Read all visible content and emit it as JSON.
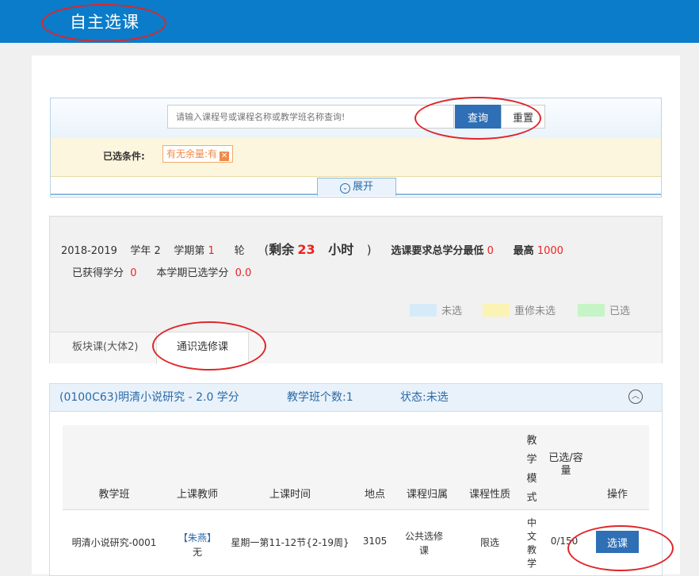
{
  "header": {
    "title": "自主选课"
  },
  "search": {
    "placeholder": "请输入课程号或课程名称或教学班名称查询!",
    "query_label": "查询",
    "reset_label": "重置"
  },
  "conditions": {
    "label": "已选条件:",
    "tag": "有无余量:有",
    "tag_close": "✕"
  },
  "expand_label": "展开",
  "summary": {
    "year": "2018-2019",
    "year_label": "学年",
    "year_suffix": "2",
    "term_label": "学期第",
    "round": "1",
    "round_label": "轮",
    "remain_open": "(",
    "remain_label": "剩余",
    "remain_value": "23",
    "remain_unit": "小时",
    "remain_close": ")",
    "credit_req_label": "选课要求总学分最低",
    "credit_min": "0",
    "credit_max_label": "最高",
    "credit_max": "1000",
    "earned_label": "已获得学分",
    "earned_value": "0",
    "term_selected_label": "本学期已选学分",
    "term_selected_value": "0.0"
  },
  "legend": [
    {
      "label": "未选",
      "color": "#d6ebf8"
    },
    {
      "label": "重修未选",
      "color": "#fbf3b4"
    },
    {
      "label": "已选",
      "color": "#c6f4c6"
    }
  ],
  "tabs": [
    {
      "label": "板块课(大体2)"
    },
    {
      "label": "通识选修课"
    }
  ],
  "course": {
    "title": "(0100C63)明清小说研究 - 2.0 学分",
    "class_count": "教学班个数:1",
    "status": "状态:未选",
    "headers": {
      "class": "教学班",
      "teacher": "上课教师",
      "time": "上课时间",
      "location": "地点",
      "belong": "课程归属",
      "nature": "课程性质",
      "mode": "教学模式",
      "capacity": "已选/容量",
      "op": "操作"
    },
    "row": {
      "class": "明清小说研究-0001",
      "teacher": "【朱燕】",
      "teacher_sub": "无",
      "time": "星期一第11-12节{2-19周}",
      "location": "3105",
      "belong": "公共选修课",
      "nature": "限选",
      "mode": "中文教学",
      "capacity": "0/150",
      "select_label": "选课"
    }
  }
}
